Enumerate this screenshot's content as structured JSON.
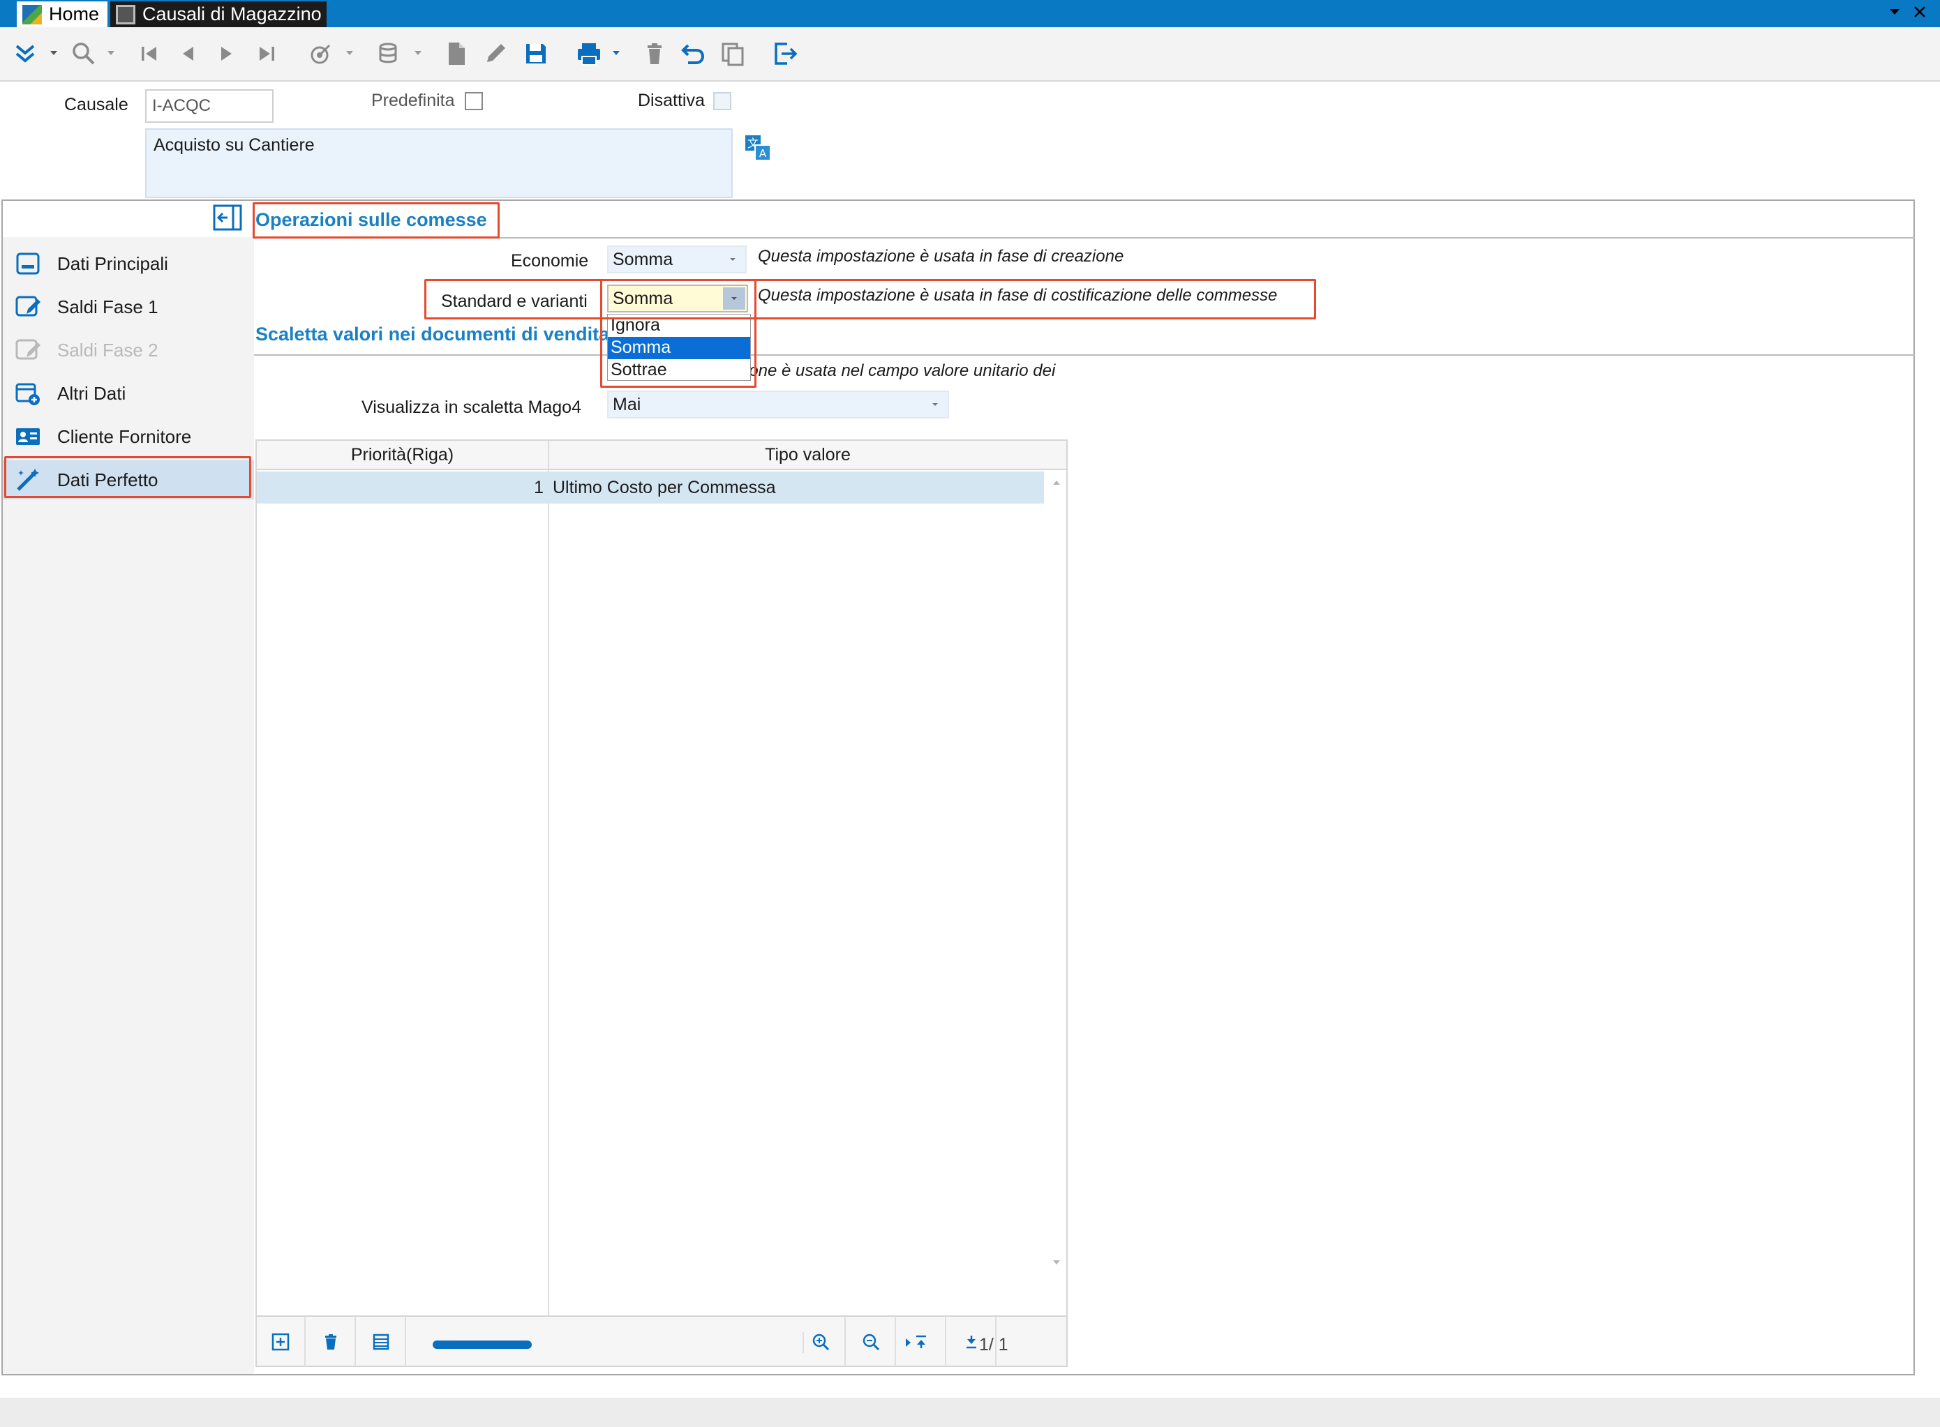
{
  "window": {
    "tabs": [
      {
        "label": "Home"
      },
      {
        "label": "Causali di Magazzino"
      }
    ]
  },
  "colors": {
    "titlebar": "#0a79c4",
    "accent_text": "#1a80c4",
    "highlight_box": "#e64a2e",
    "selected_option": "#0a6ed6",
    "field_background": "#eaf3fb"
  },
  "header": {
    "causale_label": "Causale",
    "causale_value": "I-ACQC",
    "predefinita_label": "Predefinita",
    "disattiva_label": "Disattiva",
    "description": "Acquisto su Cantiere"
  },
  "sidebar": {
    "items": [
      {
        "label": "Dati Principali",
        "icon": "form-icon"
      },
      {
        "label": "Saldi Fase 1",
        "icon": "edit-form-icon"
      },
      {
        "label": "Saldi Fase 2",
        "icon": "edit-form-icon"
      },
      {
        "label": "Altri Dati",
        "icon": "calendar-add-icon"
      },
      {
        "label": "Cliente Fornitore",
        "icon": "contact-card-icon"
      },
      {
        "label": "Dati Perfetto",
        "icon": "magic-wand-icon"
      }
    ]
  },
  "operazioni": {
    "title": "Operazioni sulle comesse",
    "economie_label": "Economie",
    "economie_value": "Somma",
    "economie_note": "Questa impostazione è usata in fase di creazione",
    "standard_label": "Standard e varianti",
    "standard_value": "Somma",
    "standard_note": "Questa impostazione è usata in fase di costificazione delle commesse",
    "dropdown_options": [
      "Ignora",
      "Somma",
      "Sottrae"
    ]
  },
  "scaletta": {
    "title": "Scaletta valori nei documenti di vendita",
    "note_partial": "ione è usata nel campo valore unitario dei",
    "visualizza_label": "Visualizza in scaletta Mago4",
    "visualizza_value": "Mai"
  },
  "grid": {
    "columns": [
      "Priorità(Riga)",
      "Tipo valore"
    ],
    "rows": [
      {
        "priorita": "1",
        "tipo_valore": "Ultimo Costo per Commessa"
      }
    ],
    "page_indicator": "1/   1"
  }
}
